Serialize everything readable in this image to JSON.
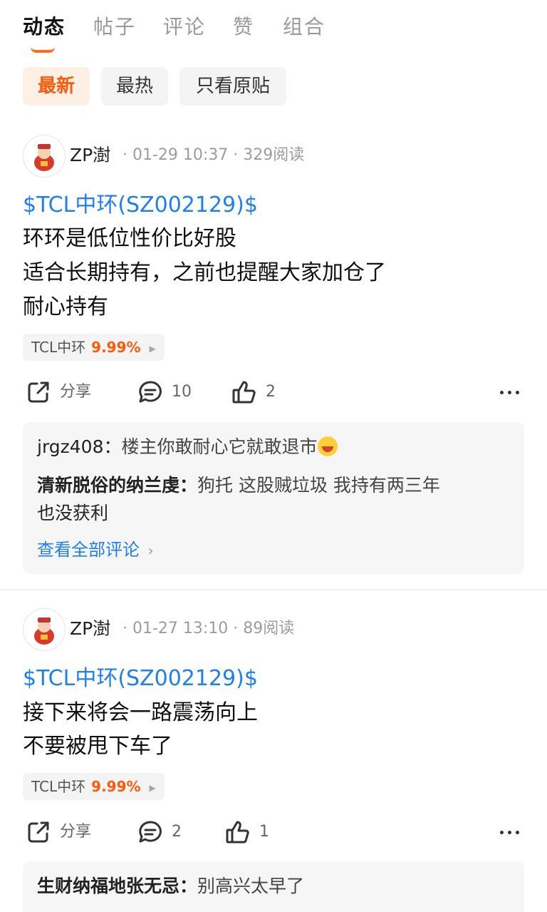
{
  "tabs": [
    {
      "label": "动态",
      "active": true
    },
    {
      "label": "帖子",
      "active": false
    },
    {
      "label": "评论",
      "active": false
    },
    {
      "label": "赞",
      "active": false
    },
    {
      "label": "组合",
      "active": false
    }
  ],
  "filters": [
    {
      "label": "最新",
      "active": true
    },
    {
      "label": "最热",
      "active": false
    },
    {
      "label": "只看原贴",
      "active": false
    }
  ],
  "accent_color": "#ff5a0a",
  "link_color": "#1f7ff0",
  "posts": [
    {
      "author": "ZP澍",
      "meta": "· 01-29 10:37 · 329阅读",
      "stock_link": "$TCL中环(SZ002129)$",
      "lines": [
        "环环是低位性价比好股",
        "适合长期持有，之前也提醒大家加仓了",
        "耐心持有"
      ],
      "stock_chip": {
        "name": "TCL中环",
        "change": "9.99%"
      },
      "share_label": "分享",
      "comment_count": "10",
      "like_count": "2",
      "comments": [
        {
          "user": "jrgz408",
          "sep": "：",
          "text": "楼主你敢耐心它就敢退市"
        },
        {
          "user": "清新脱俗的纳兰虔",
          "sep": "：",
          "text": "狗托 这股贼垃圾 我持有两三年",
          "text2": "也没获利"
        }
      ],
      "view_all": "查看全部评论"
    },
    {
      "author": "ZP澍",
      "meta": "· 01-27 13:10 · 89阅读",
      "stock_link": "$TCL中环(SZ002129)$",
      "lines": [
        "接下来将会一路震荡向上",
        "不要被甩下车了"
      ],
      "stock_chip": {
        "name": "TCL中环",
        "change": "9.99%"
      },
      "share_label": "分享",
      "comment_count": "2",
      "like_count": "1",
      "comments": [
        {
          "user": "生财纳福地张无忌",
          "sep": "：",
          "text": "别高兴太早了"
        }
      ]
    }
  ]
}
